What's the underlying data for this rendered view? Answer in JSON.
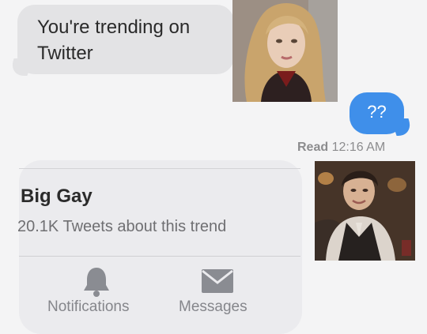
{
  "conversation": {
    "incoming_message": "You're trending on Twitter",
    "outgoing_message": "??",
    "read_receipt": {
      "status": "Read",
      "time": "12:16 AM"
    }
  },
  "trend_card": {
    "title": "Big Gay",
    "subtitle": "20.1K Tweets about this trend",
    "nav": [
      {
        "label": "Notifications",
        "icon": "bell-icon"
      },
      {
        "label": "Messages",
        "icon": "envelope-icon"
      }
    ]
  },
  "colors": {
    "incoming_bubble": "#e3e3e5",
    "outgoing_bubble": "#3f8fea",
    "card": "#ebebee",
    "icon": "#8a8c92"
  }
}
